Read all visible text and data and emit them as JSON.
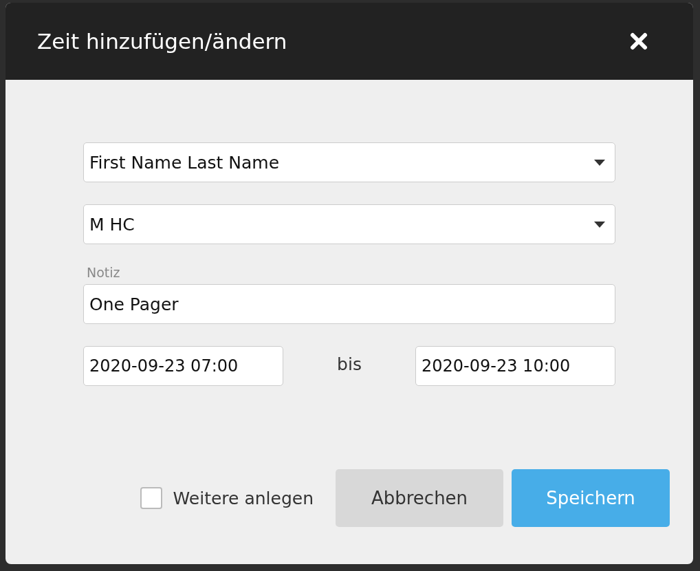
{
  "dialog": {
    "title": "Zeit hinzufügen/ändern"
  },
  "selects": [
    {
      "value": "First Name Last Name"
    },
    {
      "value": "M HC"
    }
  ],
  "note": {
    "label": "Notiz",
    "value": "One Pager"
  },
  "range": {
    "from": "2020-09-23 07:00",
    "separator": "bis",
    "to": "2020-09-23 10:00"
  },
  "more": {
    "label": "Weitere anlegen",
    "checked": false
  },
  "buttons": [
    {
      "label": "Abbrechen",
      "kind": "secondary"
    },
    {
      "label": "Speichern",
      "kind": "primary"
    }
  ]
}
